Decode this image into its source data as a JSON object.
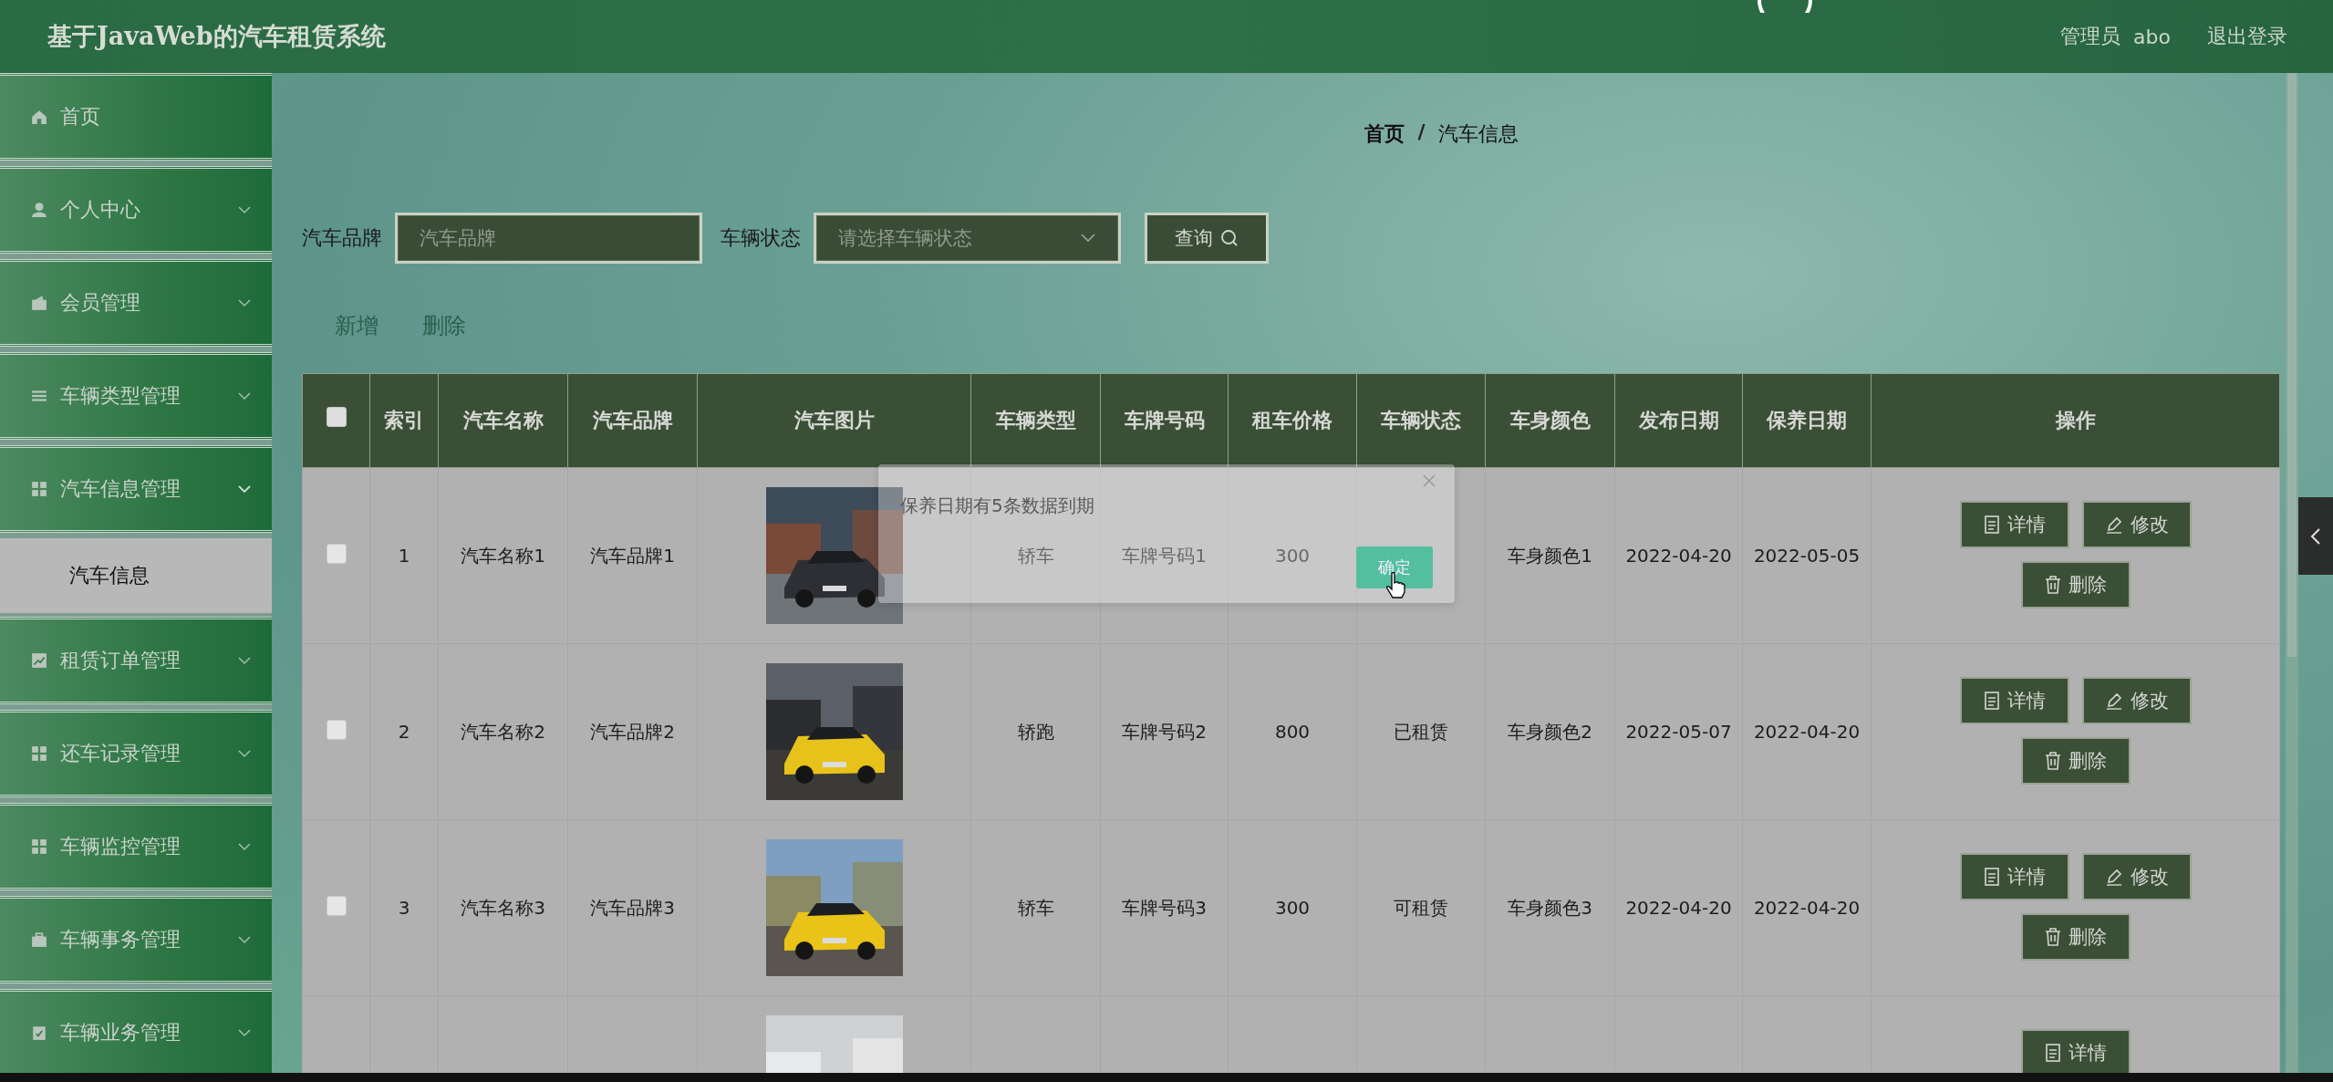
{
  "header": {
    "title": "基于JavaWeb的汽车租赁系统",
    "user_role": "管理员",
    "username": "abo",
    "logout": "退出登录"
  },
  "sidebar": {
    "items": [
      {
        "label": "首页",
        "kind": "link"
      },
      {
        "label": "个人中心",
        "kind": "group"
      },
      {
        "label": "会员管理",
        "kind": "group"
      },
      {
        "label": "车辆类型管理",
        "kind": "group"
      },
      {
        "label": "汽车信息管理",
        "kind": "group",
        "expanded": true,
        "children": [
          {
            "label": "汽车信息",
            "selected": true
          }
        ]
      },
      {
        "label": "租赁订单管理",
        "kind": "group"
      },
      {
        "label": "还车记录管理",
        "kind": "group"
      },
      {
        "label": "车辆监控管理",
        "kind": "group"
      },
      {
        "label": "车辆事务管理",
        "kind": "group"
      },
      {
        "label": "车辆业务管理",
        "kind": "group"
      }
    ]
  },
  "breadcrumb": {
    "items": [
      "首页",
      "汽车信息"
    ],
    "separator": "/"
  },
  "search": {
    "fields": [
      {
        "label": "汽车品牌",
        "placeholder": "汽车品牌",
        "kind": "text"
      },
      {
        "label": "车辆状态",
        "placeholder": "请选择车辆状态",
        "kind": "select"
      }
    ],
    "button": "查询"
  },
  "actions": [
    "新增",
    "删除"
  ],
  "table": {
    "header_checked": false,
    "columns": [
      "索引",
      "汽车名称",
      "汽车品牌",
      "汽车图片",
      "车辆类型",
      "车牌号码",
      "租车价格",
      "车辆状态",
      "车身颜色",
      "发布日期",
      "保养日期",
      "操作"
    ],
    "rows": [
      {
        "checked": false,
        "cells": [
          "1",
          "汽车名称1",
          "汽车品牌1",
          null,
          "轿车",
          "车牌号码1",
          "300",
          null,
          "车身颜色1",
          "2022-04-20",
          "2022-05-05"
        ],
        "actions": [
          {
            "label": "详情",
            "kind": "detail"
          },
          {
            "label": "修改",
            "kind": "edit"
          },
          {
            "label": "删除",
            "kind": "delete"
          }
        ]
      },
      {
        "checked": false,
        "cells": [
          "2",
          "汽车名称2",
          "汽车品牌2",
          null,
          "轿跑",
          "车牌号码2",
          "800",
          "已租赁",
          "车身颜色2",
          "2022-05-07",
          "2022-04-20"
        ],
        "actions": [
          {
            "label": "详情",
            "kind": "detail"
          },
          {
            "label": "修改",
            "kind": "edit"
          },
          {
            "label": "删除",
            "kind": "delete"
          }
        ]
      },
      {
        "checked": false,
        "cells": [
          "3",
          "汽车名称3",
          "汽车品牌3",
          null,
          "轿车",
          "车牌号码3",
          "300",
          "可租赁",
          "车身颜色3",
          "2022-04-20",
          "2022-04-20"
        ],
        "actions": [
          {
            "label": "详情",
            "kind": "detail"
          },
          {
            "label": "修改",
            "kind": "edit"
          },
          {
            "label": "删除",
            "kind": "delete"
          }
        ]
      },
      {
        "cells": [
          null,
          null,
          null,
          null,
          null,
          null,
          null,
          null,
          null,
          null,
          null
        ],
        "actions": [
          {
            "label": "详情",
            "kind": "detail"
          }
        ]
      }
    ]
  },
  "dialog": {
    "message": "保养日期有5条数据到期",
    "confirm": "确定"
  }
}
